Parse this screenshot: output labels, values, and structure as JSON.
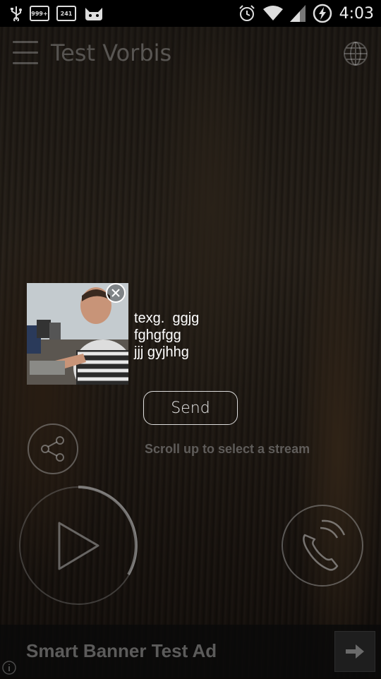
{
  "status_bar": {
    "badge_1": "999+",
    "badge_2": "241",
    "time": "4:03"
  },
  "header": {
    "title": "Test Vorbis"
  },
  "notification": {
    "message_lines": [
      "texg.  ggjg",
      "fghgfgg",
      "jjj gyjhhg"
    ]
  },
  "actions": {
    "send_label": "Send",
    "hint": "Scroll up to select a stream"
  },
  "banner": {
    "text": "Smart Banner Test Ad"
  },
  "icons": {
    "status": [
      "usb-icon",
      "notification-999-icon",
      "notification-241-icon",
      "cat-icon",
      "alarm-icon",
      "wifi-icon",
      "signal-icon",
      "battery-charging-icon"
    ],
    "header": [
      "menu-icon",
      "globe-icon"
    ],
    "controls": [
      "close-icon",
      "share-icon",
      "play-icon",
      "call-icon",
      "arrow-right-icon",
      "info-icon"
    ]
  },
  "colors": {
    "accent": "#ffffff",
    "dim_text": "#969696"
  }
}
